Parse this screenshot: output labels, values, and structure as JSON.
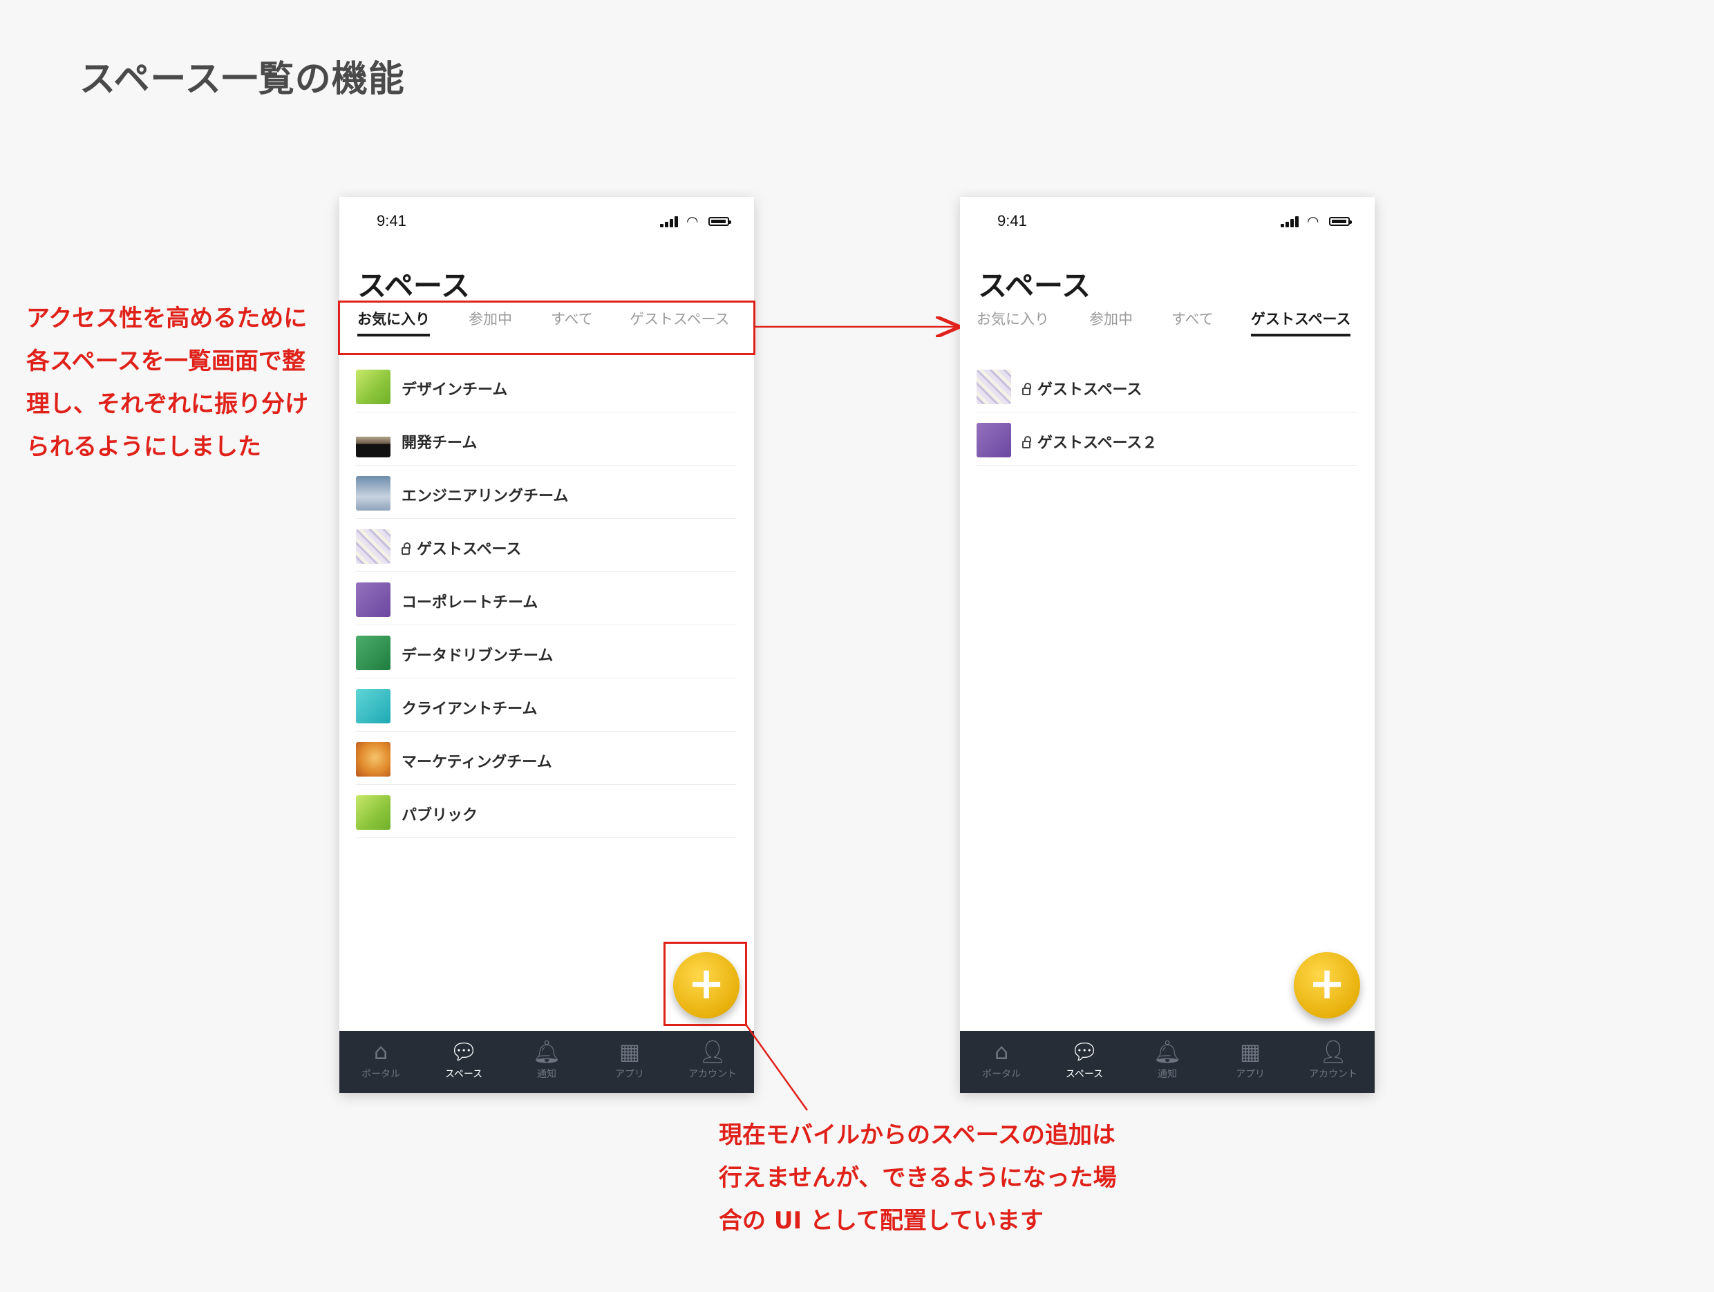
{
  "page": {
    "title": "スペース一覧の機能"
  },
  "status_bar": {
    "time": "9:41"
  },
  "screen": {
    "title": "スペース",
    "tabs": [
      "お気に入り",
      "参加中",
      "すべて",
      "ゲストスペース"
    ]
  },
  "left_phone": {
    "active_tab": "お気に入り",
    "items": [
      {
        "label": "デザインチーム",
        "locked": false,
        "thumb": "green"
      },
      {
        "label": "開発チーム",
        "locked": false,
        "thumb": "cats"
      },
      {
        "label": "エンジニアリングチーム",
        "locked": false,
        "thumb": "sky"
      },
      {
        "label": "ゲストスペース",
        "locked": true,
        "thumb": "map"
      },
      {
        "label": "コーポレートチーム",
        "locked": false,
        "thumb": "purple"
      },
      {
        "label": "データドリブンチーム",
        "locked": false,
        "thumb": "darkgreen"
      },
      {
        "label": "クライアントチーム",
        "locked": false,
        "thumb": "teal"
      },
      {
        "label": "マーケティングチーム",
        "locked": false,
        "thumb": "orange"
      },
      {
        "label": "パブリック",
        "locked": false,
        "thumb": "green"
      }
    ]
  },
  "right_phone": {
    "active_tab": "ゲストスペース",
    "items": [
      {
        "label": "ゲストスペース",
        "locked": true,
        "thumb": "map"
      },
      {
        "label": "ゲストスペース２",
        "locked": true,
        "thumb": "purple"
      }
    ]
  },
  "fab": {
    "label": "+"
  },
  "bottom_nav": [
    {
      "label": "ポータル",
      "icon": "home-icon",
      "active": false
    },
    {
      "label": "スペース",
      "icon": "speech-bubble-icon",
      "active": true
    },
    {
      "label": "通知",
      "icon": "bell-icon",
      "active": false
    },
    {
      "label": "アプリ",
      "icon": "grid-icon",
      "active": false
    },
    {
      "label": "アカウント",
      "icon": "person-icon",
      "active": false
    }
  ],
  "annotations": {
    "tabs_note": "アクセス性を高めるために\n各スペースを一覧画面で整\n理し、それぞれに振り分け\nられるようにしました",
    "fab_note": "現在モバイルからのスペースの追加は\n行えませんが、できるようになった場\n合の UI として配置しています"
  },
  "colors": {
    "annotation": "#e0211a",
    "nav_bg": "#262d37",
    "fab": "#f2c01b"
  }
}
